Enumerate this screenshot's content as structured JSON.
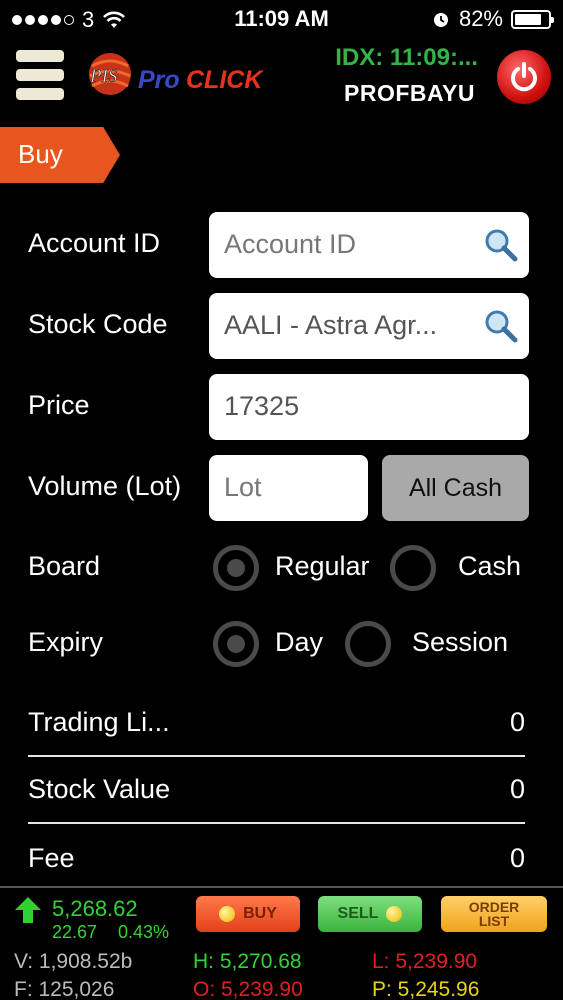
{
  "status_bar": {
    "carrier": "3",
    "time": "11:09 AM",
    "battery": "82%",
    "battery_level": 0.82
  },
  "header": {
    "logo_text": "ProCLICK",
    "logo_badge": "PIS",
    "idx_clock": "IDX: 11:09:...",
    "username": "PROFBAYU"
  },
  "page": {
    "tag": "Buy"
  },
  "form": {
    "account_id": {
      "label": "Account ID",
      "placeholder": "Account ID"
    },
    "stock_code": {
      "label": "Stock Code",
      "value": "AALI - Astra Agr..."
    },
    "price": {
      "label": "Price",
      "value": "17325"
    },
    "volume": {
      "label": "Volume (Lot)",
      "placeholder": "Lot",
      "button": "All Cash"
    },
    "board": {
      "label": "Board",
      "options": [
        "Regular",
        "Cash"
      ],
      "selected": "Regular"
    },
    "expiry": {
      "label": "Expiry",
      "options": [
        "Day",
        "Session"
      ],
      "selected": "Day"
    }
  },
  "summary": [
    {
      "label": "Trading Li...",
      "value": "0"
    },
    {
      "label": "Stock Value",
      "value": "0"
    },
    {
      "label": "Fee",
      "value": "0"
    }
  ],
  "ticker": {
    "index": "5,268.62",
    "change": "22.67",
    "change_pct": "0.43%",
    "volume": "V: 1,908.52b",
    "frequency": "F: 125,026",
    "high": "H: 5,270.68",
    "open": "O: 5,239.90",
    "low": "L: 5,239.90",
    "prev": "P: 5,245.96",
    "buttons": {
      "buy": "BUY",
      "sell": "SELL",
      "order_line1": "ORDER",
      "order_line2": "LIST"
    }
  },
  "colors": {
    "accent": "#e8561f",
    "idx_green": "#33b34a",
    "power_red": "#d01010"
  }
}
